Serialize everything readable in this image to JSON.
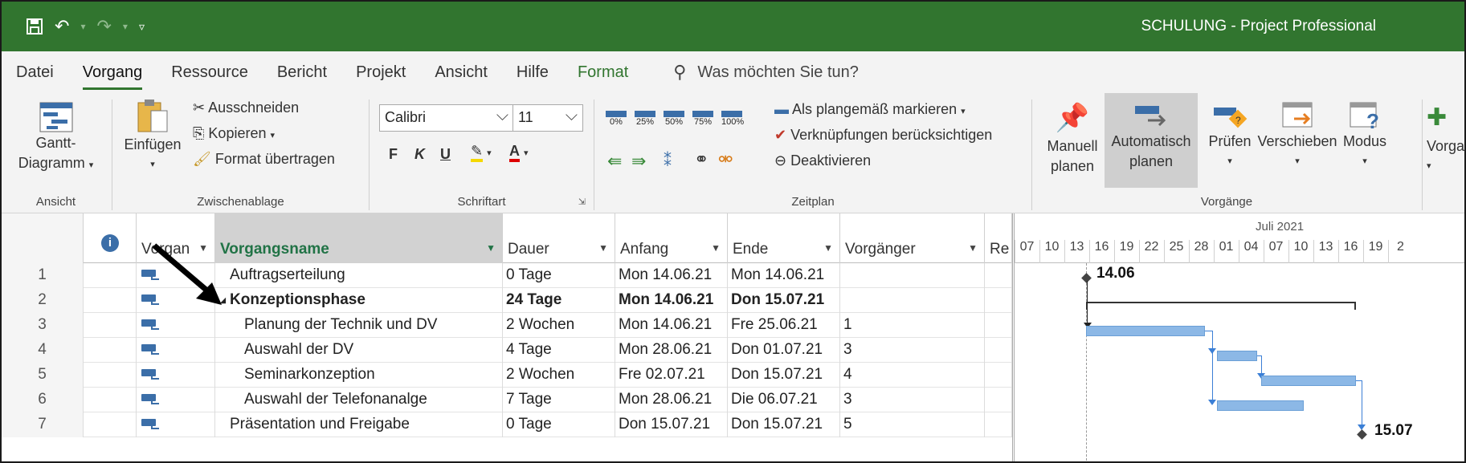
{
  "window": {
    "title": "SCHULUNG  -  Project Professional"
  },
  "quick_access": {
    "save": "save-icon",
    "undo": "undo-icon",
    "redo": "redo-icon",
    "customize": "customize-icon"
  },
  "tabs": [
    {
      "label": "Datei"
    },
    {
      "label": "Vorgang"
    },
    {
      "label": "Ressource"
    },
    {
      "label": "Bericht"
    },
    {
      "label": "Projekt"
    },
    {
      "label": "Ansicht"
    },
    {
      "label": "Hilfe"
    },
    {
      "label": "Format"
    }
  ],
  "tell_me": "Was möchten Sie tun?",
  "ribbon": {
    "ansicht": {
      "gantt_line1": "Gantt-",
      "gantt_line2": "Diagramm",
      "group": "Ansicht"
    },
    "zwischenablage": {
      "paste": "Einfügen",
      "cut": "Ausschneiden",
      "copy": "Kopieren",
      "format_painter": "Format übertragen",
      "group": "Zwischenablage"
    },
    "schriftart": {
      "font": "Calibri",
      "size": "11",
      "bold": "F",
      "italic": "K",
      "underline": "U",
      "group": "Schriftart"
    },
    "zeitplan": {
      "pct": [
        "0%",
        "25%",
        "50%",
        "75%",
        "100%"
      ],
      "mark_on_track": "Als plangemäß markieren",
      "respect_links": "Verknüpfungen berücksichtigen",
      "inactivate": "Deaktivieren",
      "group": "Zeitplan"
    },
    "vorgaenge": {
      "manual_1": "Manuell",
      "manual_2": "planen",
      "auto_1": "Automatisch",
      "auto_2": "planen",
      "inspect": "Prüfen",
      "move": "Verschieben",
      "mode": "Modus",
      "task_partial": "Vorga",
      "group": "Vorgänge"
    }
  },
  "columns": {
    "mode": "Vorgan",
    "name": "Vorgangsname",
    "duration": "Dauer",
    "start": "Anfang",
    "finish": "Ende",
    "predecessors": "Vorgänger",
    "resources": "Re"
  },
  "rows": [
    {
      "id": "1",
      "name": "Auftragserteilung",
      "duration": "0 Tage",
      "start": "Mon 14.06.21",
      "finish": "Mon 14.06.21",
      "pred": ""
    },
    {
      "id": "2",
      "name": "Konzeptionsphase",
      "duration": "24 Tage",
      "start": "Mon 14.06.21",
      "finish": "Don 15.07.21",
      "pred": ""
    },
    {
      "id": "3",
      "name": "Planung der Technik und DV",
      "duration": "2 Wochen",
      "start": "Mon 14.06.21",
      "finish": "Fre 25.06.21",
      "pred": "1"
    },
    {
      "id": "4",
      "name": "Auswahl der DV",
      "duration": "4 Tage",
      "start": "Mon 28.06.21",
      "finish": "Don 01.07.21",
      "pred": "3"
    },
    {
      "id": "5",
      "name": "Seminarkonzeption",
      "duration": "2 Wochen",
      "start": "Fre 02.07.21",
      "finish": "Don 15.07.21",
      "pred": "4"
    },
    {
      "id": "6",
      "name": "Auswahl der Telefonanalge",
      "duration": "7 Tage",
      "start": "Mon 28.06.21",
      "finish": "Die 06.07.21",
      "pred": "3"
    },
    {
      "id": "7",
      "name": "Präsentation und Freigabe",
      "duration": "0 Tage",
      "start": "Don 15.07.21",
      "finish": "Don 15.07.21",
      "pred": "5"
    }
  ],
  "timeline": {
    "month": "Juli 2021",
    "days": [
      "07",
      "10",
      "13",
      "16",
      "19",
      "22",
      "25",
      "28",
      "01",
      "04",
      "07",
      "10",
      "13",
      "16",
      "19",
      "2"
    ],
    "milestone1": "14.06",
    "milestone2": "15.07"
  }
}
